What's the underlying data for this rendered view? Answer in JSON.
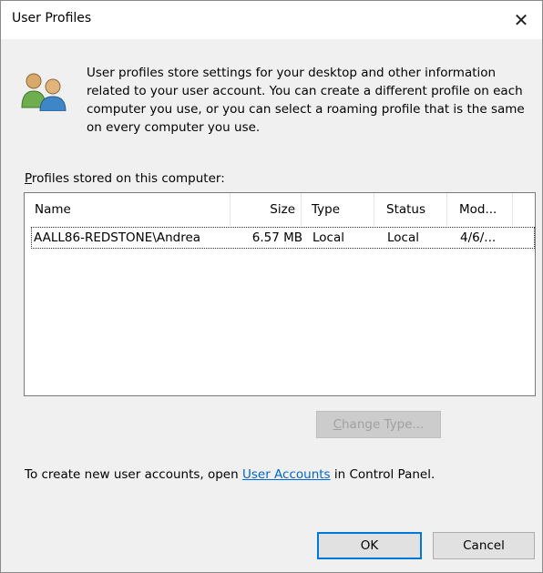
{
  "window": {
    "title": "User Profiles",
    "close_glyph": "✕"
  },
  "intro": {
    "icon": "users-icon",
    "text": "User profiles store settings for your desktop and other information related to your user account. You can create a different profile on each computer you use, or you can select a roaming profile that is the same on every computer you use."
  },
  "profiles": {
    "label_accel": "P",
    "label_rest": "rofiles stored on this computer:",
    "columns": [
      "Name",
      "Size",
      "Type",
      "Status",
      "Mod..."
    ],
    "rows": [
      {
        "name": "AALL86-REDSTONE\\Andrea",
        "size": "6.57 MB",
        "type": "Local",
        "status": "Local",
        "modified": "4/6/..."
      }
    ]
  },
  "change_type": {
    "accel": "C",
    "rest": "hange Type..."
  },
  "footnote": {
    "before": "To create new user accounts, open ",
    "link": "User Accounts",
    "after": " in Control Panel."
  },
  "buttons": {
    "ok": "OK",
    "cancel": "Cancel"
  }
}
